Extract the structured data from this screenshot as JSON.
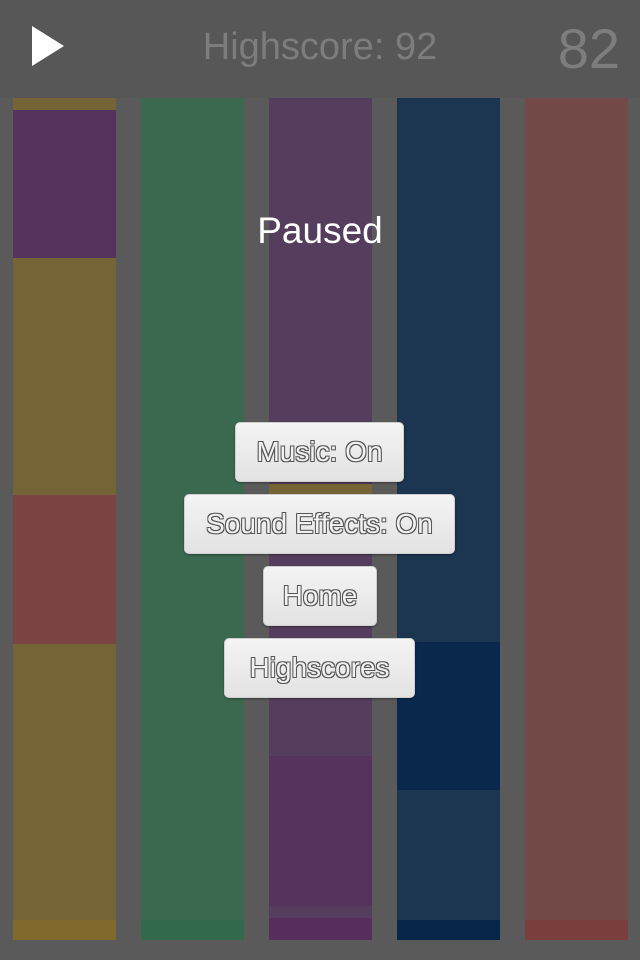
{
  "header": {
    "play_icon": "play-icon",
    "highscore_label": "Highscore: 92",
    "score": "82"
  },
  "overlay": {
    "title": "Paused",
    "buttons": {
      "music": "Music: On",
      "sound_effects": "Sound Effects: On",
      "home": "Home",
      "highscores": "Highscores"
    }
  },
  "colors": {
    "yellow": "#756536",
    "purple": "#55335c",
    "red": "#7a4442",
    "green": "#3a6950",
    "dim_purple": "#553e5d",
    "dark_blue": "#1c3550",
    "deep_blue": "#0a284d",
    "dim_red": "#744a48"
  }
}
